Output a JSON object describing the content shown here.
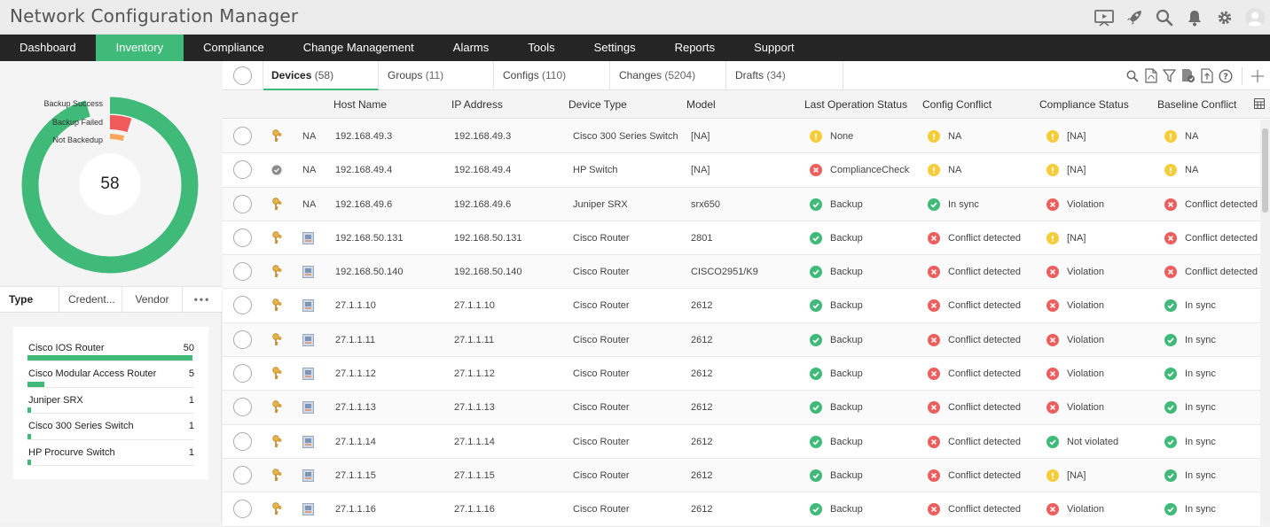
{
  "app": {
    "title": "Network Configuration Manager"
  },
  "top_icons": [
    "presentation-icon",
    "rocket-icon",
    "search-icon",
    "bell-icon",
    "gear-icon",
    "user-avatar-icon"
  ],
  "nav": {
    "items": [
      {
        "label": "Dashboard",
        "active": false
      },
      {
        "label": "Inventory",
        "active": true
      },
      {
        "label": "Compliance",
        "active": false
      },
      {
        "label": "Change Management",
        "active": false
      },
      {
        "label": "Alarms",
        "active": false
      },
      {
        "label": "Tools",
        "active": false
      },
      {
        "label": "Settings",
        "active": false
      },
      {
        "label": "Reports",
        "active": false
      },
      {
        "label": "Support",
        "active": false
      }
    ]
  },
  "donut": {
    "total": "58",
    "legend": [
      "Backup Success",
      "Backup Failed",
      "Not Backedup"
    ],
    "colors": {
      "success": "#3fba79",
      "failed": "#f05a5a",
      "not_backed": "#f7a85c"
    }
  },
  "filter_tabs": [
    "Type",
    "Credent...",
    "Vendor",
    "•••"
  ],
  "device_types": [
    {
      "name": "Cisco IOS Router",
      "count": "50",
      "share": 1.0
    },
    {
      "name": "Cisco Modular Access Router",
      "count": "5",
      "share": 0.1
    },
    {
      "name": "Juniper SRX",
      "count": "1",
      "share": 0.02
    },
    {
      "name": "Cisco 300 Series Switch",
      "count": "1",
      "share": 0.02
    },
    {
      "name": "HP Procurve Switch",
      "count": "1",
      "share": 0.02
    }
  ],
  "subtabs": [
    {
      "label": "Devices",
      "count": "(58)",
      "active": true
    },
    {
      "label": "Groups",
      "count": "(11)",
      "active": false
    },
    {
      "label": "Configs",
      "count": "(110)",
      "active": false
    },
    {
      "label": "Changes",
      "count": "(5204)",
      "active": false
    },
    {
      "label": "Drafts",
      "count": "(34)",
      "active": false
    }
  ],
  "toolbar_icons": [
    "search-icon",
    "pdf-icon",
    "filter-icon",
    "device-report-icon",
    "export-icon",
    "help-icon",
    "add-icon"
  ],
  "columns": [
    "Host Name",
    "IP Address",
    "Device Type",
    "Model",
    "Last Operation Status",
    "Config Conflict",
    "Compliance Status",
    "Baseline Conflict"
  ],
  "rows": [
    {
      "icon": "key",
      "na": "NA",
      "host": "192.168.49.3",
      "ip": "192.168.49.3",
      "type": "Cisco 300 Series Switch",
      "model": "[NA]",
      "last_op": {
        "state": "warn",
        "text": "None"
      },
      "config": {
        "state": "warn",
        "text": "NA"
      },
      "compliance": {
        "state": "warn",
        "text": "[NA]"
      },
      "baseline": {
        "state": "warn",
        "text": "NA"
      }
    },
    {
      "icon": "gray",
      "na": "NA",
      "host": "192.168.49.4",
      "ip": "192.168.49.4",
      "type": "HP Switch",
      "model": "[NA]",
      "last_op": {
        "state": "error",
        "text": "ComplianceCheck"
      },
      "config": {
        "state": "warn",
        "text": "NA"
      },
      "compliance": {
        "state": "warn",
        "text": "[NA]"
      },
      "baseline": {
        "state": "warn",
        "text": "NA"
      }
    },
    {
      "icon": "key",
      "na": "NA",
      "host": "192.168.49.6",
      "ip": "192.168.49.6",
      "type": "Juniper SRX",
      "model": "srx650",
      "last_op": {
        "state": "ok",
        "text": "Backup"
      },
      "config": {
        "state": "ok",
        "text": "In sync"
      },
      "compliance": {
        "state": "error",
        "text": "Violation"
      },
      "baseline": {
        "state": "error",
        "text": "Conflict detected"
      }
    },
    {
      "icon": "key",
      "na": "",
      "host": "192.168.50.131",
      "ip": "192.168.50.131",
      "type": "Cisco Router",
      "model": "2801",
      "last_op": {
        "state": "ok",
        "text": "Backup"
      },
      "config": {
        "state": "error",
        "text": "Conflict detected"
      },
      "compliance": {
        "state": "warn",
        "text": "[NA]"
      },
      "baseline": {
        "state": "error",
        "text": "Conflict detected"
      }
    },
    {
      "icon": "key",
      "na": "",
      "host": "192.168.50.140",
      "ip": "192.168.50.140",
      "type": "Cisco Router",
      "model": "CISCO2951/K9",
      "last_op": {
        "state": "ok",
        "text": "Backup"
      },
      "config": {
        "state": "error",
        "text": "Conflict detected"
      },
      "compliance": {
        "state": "error",
        "text": "Violation"
      },
      "baseline": {
        "state": "error",
        "text": "Conflict detected"
      }
    },
    {
      "icon": "key",
      "na": "",
      "host": "27.1.1.10",
      "ip": "27.1.1.10",
      "type": "Cisco Router",
      "model": "2612",
      "last_op": {
        "state": "ok",
        "text": "Backup"
      },
      "config": {
        "state": "error",
        "text": "Conflict detected"
      },
      "compliance": {
        "state": "error",
        "text": "Violation"
      },
      "baseline": {
        "state": "ok",
        "text": "In sync"
      }
    },
    {
      "icon": "key",
      "na": "",
      "host": "27.1.1.11",
      "ip": "27.1.1.11",
      "type": "Cisco Router",
      "model": "2612",
      "last_op": {
        "state": "ok",
        "text": "Backup"
      },
      "config": {
        "state": "error",
        "text": "Conflict detected"
      },
      "compliance": {
        "state": "error",
        "text": "Violation"
      },
      "baseline": {
        "state": "ok",
        "text": "In sync"
      }
    },
    {
      "icon": "key",
      "na": "",
      "host": "27.1.1.12",
      "ip": "27.1.1.12",
      "type": "Cisco Router",
      "model": "2612",
      "last_op": {
        "state": "ok",
        "text": "Backup"
      },
      "config": {
        "state": "error",
        "text": "Conflict detected"
      },
      "compliance": {
        "state": "error",
        "text": "Violation"
      },
      "baseline": {
        "state": "ok",
        "text": "In sync"
      }
    },
    {
      "icon": "key",
      "na": "",
      "host": "27.1.1.13",
      "ip": "27.1.1.13",
      "type": "Cisco Router",
      "model": "2612",
      "last_op": {
        "state": "ok",
        "text": "Backup"
      },
      "config": {
        "state": "error",
        "text": "Conflict detected"
      },
      "compliance": {
        "state": "error",
        "text": "Violation"
      },
      "baseline": {
        "state": "ok",
        "text": "In sync"
      }
    },
    {
      "icon": "key",
      "na": "",
      "host": "27.1.1.14",
      "ip": "27.1.1.14",
      "type": "Cisco Router",
      "model": "2612",
      "last_op": {
        "state": "ok",
        "text": "Backup"
      },
      "config": {
        "state": "error",
        "text": "Conflict detected"
      },
      "compliance": {
        "state": "ok",
        "text": "Not violated"
      },
      "baseline": {
        "state": "ok",
        "text": "In sync"
      }
    },
    {
      "icon": "key",
      "na": "",
      "host": "27.1.1.15",
      "ip": "27.1.1.15",
      "type": "Cisco Router",
      "model": "2612",
      "last_op": {
        "state": "ok",
        "text": "Backup"
      },
      "config": {
        "state": "error",
        "text": "Conflict detected"
      },
      "compliance": {
        "state": "warn",
        "text": "[NA]"
      },
      "baseline": {
        "state": "ok",
        "text": "In sync"
      }
    },
    {
      "icon": "key",
      "na": "",
      "host": "27.1.1.16",
      "ip": "27.1.1.16",
      "type": "Cisco Router",
      "model": "2612",
      "last_op": {
        "state": "ok",
        "text": "Backup"
      },
      "config": {
        "state": "error",
        "text": "Conflict detected"
      },
      "compliance": {
        "state": "error",
        "text": "Violation"
      },
      "baseline": {
        "state": "ok",
        "text": "In sync"
      }
    }
  ],
  "status_colors": {
    "ok": "#3fba79",
    "error": "#ec5f5f",
    "warn": "#f5cc3a"
  }
}
